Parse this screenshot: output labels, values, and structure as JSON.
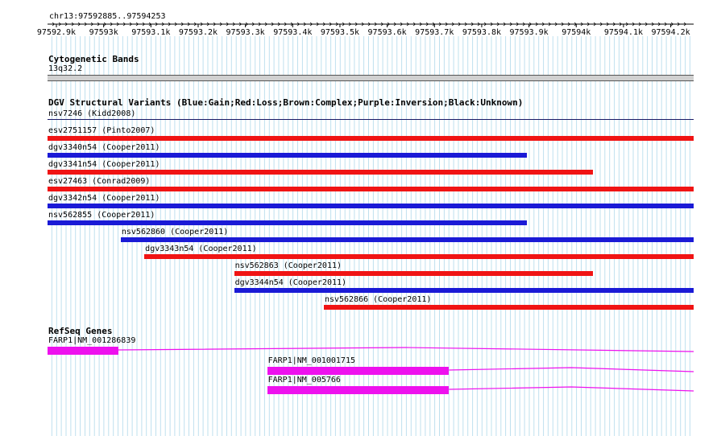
{
  "ruler": {
    "region": "chr13:97592885..97594253",
    "ticks": [
      "97592.9k",
      "97593k",
      "97593.1k",
      "97593.2k",
      "97593.3k",
      "97593.4k",
      "97593.5k",
      "97593.6k",
      "97593.7k",
      "97593.8k",
      "97593.9k",
      "97594k",
      "97594.1k",
      "97594.2k"
    ]
  },
  "region_range": [
    97592885,
    97594253
  ],
  "cytoband": {
    "title": "Cytogenetic Bands",
    "label": "13q32.2"
  },
  "dgv": {
    "title": "DGV Structural Variants (Blue:Gain;Red:Loss;Brown:Complex;Purple:Inversion;Black:Unknown)",
    "colors": {
      "gain": "#1a1ad6",
      "loss": "#f01414",
      "unknown": "#1a1a66"
    },
    "variants": [
      {
        "label": "nsv7246 (Kidd2008)",
        "type": "unknown",
        "start": 97592885,
        "end": 97594253
      },
      {
        "label": "esv2751157 (Pinto2007)",
        "type": "loss",
        "start": 97592885,
        "end": 97594253
      },
      {
        "label": "dgv3340n54 (Cooper2011)",
        "type": "gain",
        "start": 97592885,
        "end": 97593900
      },
      {
        "label": "dgv3341n54 (Cooper2011)",
        "type": "loss",
        "start": 97592885,
        "end": 97594040
      },
      {
        "label": "esv27463 (Conrad2009)",
        "type": "loss",
        "start": 97592885,
        "end": 97594253
      },
      {
        "label": "dgv3342n54 (Cooper2011)",
        "type": "gain",
        "start": 97592885,
        "end": 97594253
      },
      {
        "label": "nsv562855 (Cooper2011)",
        "type": "gain",
        "start": 97592885,
        "end": 97593900
      },
      {
        "label": "nsv562860 (Cooper2011)",
        "type": "gain",
        "start": 97593040,
        "end": 97594253
      },
      {
        "label": "dgv3343n54 (Cooper2011)",
        "type": "loss",
        "start": 97593090,
        "end": 97594253
      },
      {
        "label": "nsv562863 (Cooper2011)",
        "type": "loss",
        "start": 97593280,
        "end": 97594040
      },
      {
        "label": "dgv3344n54 (Cooper2011)",
        "type": "gain",
        "start": 97593280,
        "end": 97594253
      },
      {
        "label": "nsv562866 (Cooper2011)",
        "type": "loss",
        "start": 97593470,
        "end": 97594253
      }
    ]
  },
  "refseq": {
    "title": "RefSeq Genes",
    "color": "#ee11ee",
    "genes": [
      {
        "label": "FARP1|NM_001286839",
        "exon": [
          97592885,
          97593035
        ],
        "line_end": 97594253
      },
      {
        "label": "FARP1|NM_001001715",
        "exon": [
          97593350,
          97593735
        ],
        "line_end": 97594253
      },
      {
        "label": "FARP1|NM_005766",
        "exon": [
          97593350,
          97593735
        ],
        "line_end": 97594253
      }
    ]
  }
}
